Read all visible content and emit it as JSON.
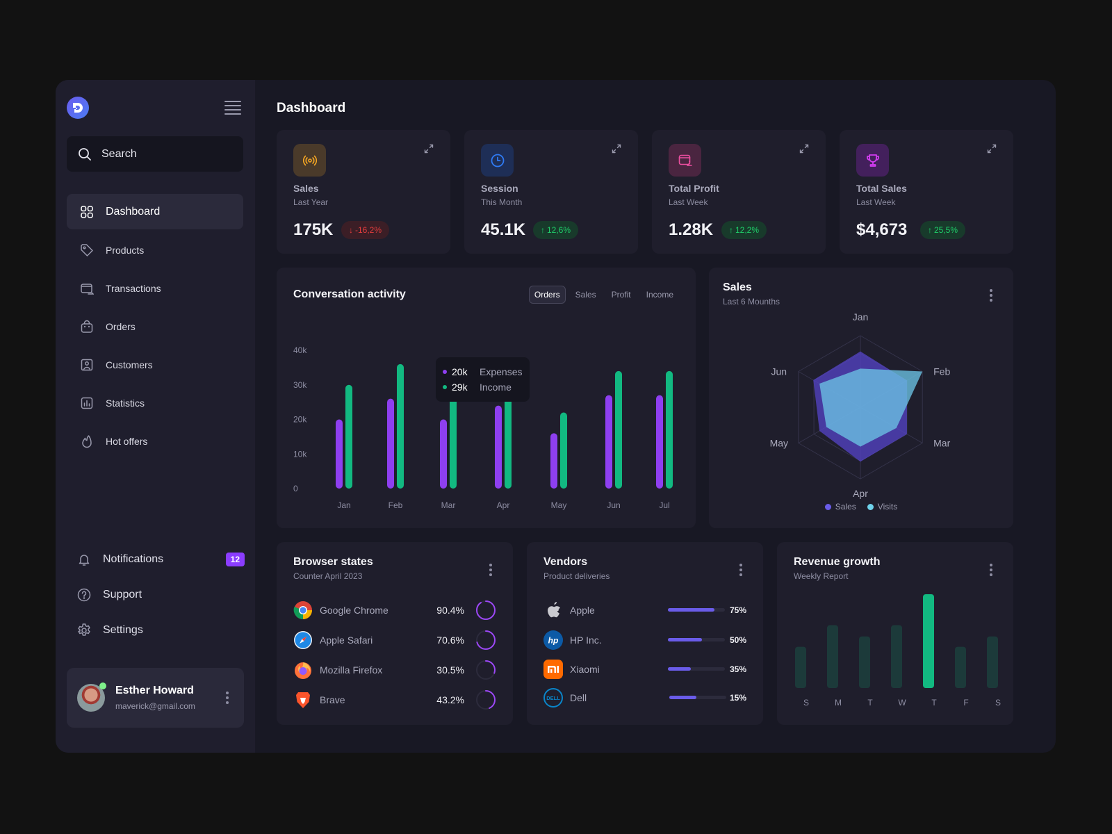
{
  "sidebar": {
    "search": {
      "placeholder": "Search"
    },
    "nav": [
      {
        "label": "Dashboard",
        "icon": "grid-icon",
        "active": true
      },
      {
        "label": "Products",
        "icon": "tag-icon"
      },
      {
        "label": "Transactions",
        "icon": "wallet-icon"
      },
      {
        "label": "Orders",
        "icon": "bag-icon"
      },
      {
        "label": "Customers",
        "icon": "user-card-icon"
      },
      {
        "label": "Statistics",
        "icon": "chart-icon"
      },
      {
        "label": "Hot offers",
        "icon": "flame-icon"
      }
    ],
    "bottom": [
      {
        "label": "Notifications",
        "icon": "bell-icon",
        "badge": "12"
      },
      {
        "label": "Support",
        "icon": "help-icon"
      },
      {
        "label": "Settings",
        "icon": "gear-icon"
      }
    ],
    "profile": {
      "name": "Esther Howard",
      "email": "maverick@gmail.com",
      "online": true
    }
  },
  "main": {
    "title": "Dashboard",
    "stats": [
      {
        "label": "Sales",
        "sub": "Last Year",
        "value": "175K",
        "change": "-16,2%",
        "direction": "down",
        "icon": "broadcast-icon",
        "icon_color": "#f5a623",
        "icon_bg": "#4a3a2a"
      },
      {
        "label": "Session",
        "sub": "This Month",
        "value": "45.1K",
        "change": "12,6%",
        "direction": "up",
        "icon": "clock-icon",
        "icon_color": "#2f7bf5",
        "icon_bg": "#1e2e56"
      },
      {
        "label": "Total Profit",
        "sub": "Last Week",
        "value": "1.28K",
        "change": "12,2%",
        "direction": "up",
        "icon": "wallet-transfer-icon",
        "icon_color": "#ec4fa0",
        "icon_bg": "#4a2540"
      },
      {
        "label": "Total Sales",
        "sub": "Last Week",
        "value": "$4,673",
        "change": "25,5%",
        "direction": "up",
        "icon": "trophy-icon",
        "icon_color": "#d23cf0",
        "icon_bg": "#43205c"
      }
    ],
    "activity": {
      "title": "Conversation activity",
      "tabs": [
        "Orders",
        "Sales",
        "Profit",
        "Income"
      ],
      "active_tab": "Orders",
      "tooltip": [
        {
          "value": "20k",
          "label": "Expenses",
          "color": "#8e3ff0"
        },
        {
          "value": "29k",
          "label": "Income",
          "color": "#12b981"
        }
      ]
    },
    "sales_radar": {
      "title": "Sales",
      "subtitle": "Last 6 Mounths"
    },
    "browsers": {
      "title": "Browser states",
      "subtitle": "Counter April 2023",
      "items": [
        {
          "name": "Google Chrome",
          "pct": "90.4%",
          "value": 90.4,
          "icon": "chrome-icon"
        },
        {
          "name": "Apple Safari",
          "pct": "70.6%",
          "value": 70.6,
          "icon": "safari-icon"
        },
        {
          "name": "Mozilla Firefox",
          "pct": "30.5%",
          "value": 30.5,
          "icon": "firefox-icon"
        },
        {
          "name": "Brave",
          "pct": "43.2%",
          "value": 43.2,
          "icon": "brave-icon"
        }
      ]
    },
    "vendors": {
      "title": "Vendors",
      "subtitle": "Product deliveries",
      "items": [
        {
          "name": "Apple",
          "pct": "75%",
          "value": 75,
          "icon": "apple-icon"
        },
        {
          "name": "HP Inc.",
          "pct": "50%",
          "value": 50,
          "icon": "hp-icon"
        },
        {
          "name": "Xiaomi",
          "pct": "35%",
          "value": 35,
          "icon": "xiaomi-icon"
        },
        {
          "name": "Dell",
          "pct": "15%",
          "value": 15,
          "icon": "dell-icon"
        }
      ]
    },
    "revenue": {
      "title": "Revenue growth",
      "subtitle": "Weekly Report"
    }
  },
  "colors": {
    "purple": "#8e3ff0",
    "green": "#12b981",
    "indigo": "#6a5ce9",
    "cyan": "#6fd3ec"
  },
  "chart_data": [
    {
      "type": "bar",
      "title": "Conversation activity",
      "categories": [
        "Jan",
        "Feb",
        "Mar",
        "Apr",
        "May",
        "Jun",
        "Jul"
      ],
      "series": [
        {
          "name": "Expenses",
          "color": "#8e3ff0",
          "values": [
            20,
            26,
            20,
            24,
            16,
            27,
            27
          ]
        },
        {
          "name": "Income",
          "color": "#12b981",
          "values": [
            30,
            36,
            29,
            29,
            22,
            34,
            34
          ]
        }
      ],
      "yticks": [
        "0",
        "10k",
        "20k",
        "30k",
        "40k"
      ],
      "ylim": [
        0,
        40
      ],
      "yunit": "k",
      "grid": false
    },
    {
      "type": "radar",
      "title": "Sales",
      "subtitle": "Last 6 Mounths",
      "categories": [
        "Jan",
        "Feb",
        "Mar",
        "Apr",
        "May",
        "Jun"
      ],
      "series": [
        {
          "name": "Sales",
          "color": "#6a5ce9",
          "values": [
            0.78,
            0.75,
            0.75,
            0.76,
            0.66,
            0.76
          ]
        },
        {
          "name": "Visits",
          "color": "#6fd3ec",
          "values": [
            0.54,
            1.0,
            0.58,
            0.55,
            0.55,
            0.66
          ]
        }
      ],
      "range": [
        0,
        1
      ],
      "legend": "bottom"
    },
    {
      "type": "bar",
      "title": "Revenue growth",
      "subtitle": "Weekly Report",
      "categories": [
        "S",
        "M",
        "T",
        "W",
        "T",
        "F",
        "S"
      ],
      "values": [
        0.44,
        0.67,
        0.55,
        0.67,
        1.0,
        0.44,
        0.55
      ],
      "highlight_index": 4,
      "ylim": [
        0,
        1
      ]
    }
  ]
}
